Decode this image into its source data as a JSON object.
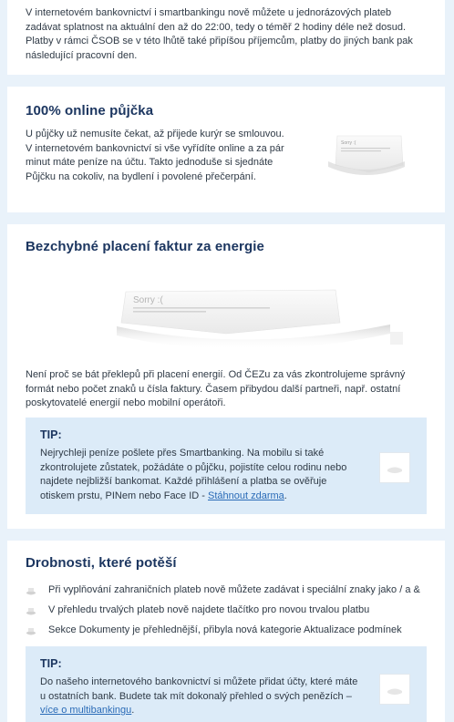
{
  "intro": {
    "text": "V internetovém bankovnictví i smartbankingu nově můžete u jednorázových plateb zadávat splatnost na aktuální den až do 22:00, tedy o téměř 2 hodiny déle než dosud. Platby v rámci ČSOB se v této lhůtě také připíšou příjemcům, platby do jiných bank pak následující pracovní den."
  },
  "online_loan": {
    "title": "100% online půjčka",
    "text": "U půjčky už nemusíte čekat, až přijede kurýr se smlouvou. V internetovém bankovnictví si vše vyřídíte online a za pár minut máte peníze na účtu. Takto jednoduše si sjednáte Půjčku na cokoliv, na bydlení i povolené přečerpání.",
    "image_text": "Sorry :("
  },
  "energy": {
    "title": "Bezchybné placení faktur za energie",
    "image_text": "Sorry :(",
    "text": "Není proč se bát překlepů při placení energií. Od ČEZu za vás zkontrolujeme správný formát nebo počet znaků u čísla faktury. Časem přibydou další partneři, např. ostatní poskytovatelé energií nebo mobilní operátoři.",
    "tip": {
      "title": "TIP:",
      "text": "Nejrychleji peníze pošlete přes Smartbanking. Na mobilu si také zkontrolujete zůstatek, požádáte o půjčku, pojistíte celou rodinu nebo najdete nejbližší bankomat. Každé přihlášení a platba se ověřuje otiskem prstu, PINem nebo Face ID - ",
      "link": "Stáhnout zdarma",
      "after": "."
    }
  },
  "small_things": {
    "title": "Drobnosti, které potěší",
    "items": [
      "Při vyplňování zahraničních plateb nově můžete zadávat i speciální znaky jako / a &",
      "V přehledu trvalých plateb nově najdete tlačítko pro novou trvalou platbu",
      "Sekce Dokumenty je přehlednější, přibyla nová kategorie Aktualizace podmínek"
    ],
    "tip": {
      "title": "TIP:",
      "text": "Do našeho internetového bankovnictví si můžete přidat účty, které máte u ostatních bank. Budete tak mít dokonalý přehled o svých penězích – ",
      "link": "více o multibankingu",
      "after": "."
    }
  },
  "colors": {
    "background": "#e9f2fa",
    "heading": "#1c3660",
    "tip_background": "#dcebf8",
    "link": "#2a6bb7"
  }
}
